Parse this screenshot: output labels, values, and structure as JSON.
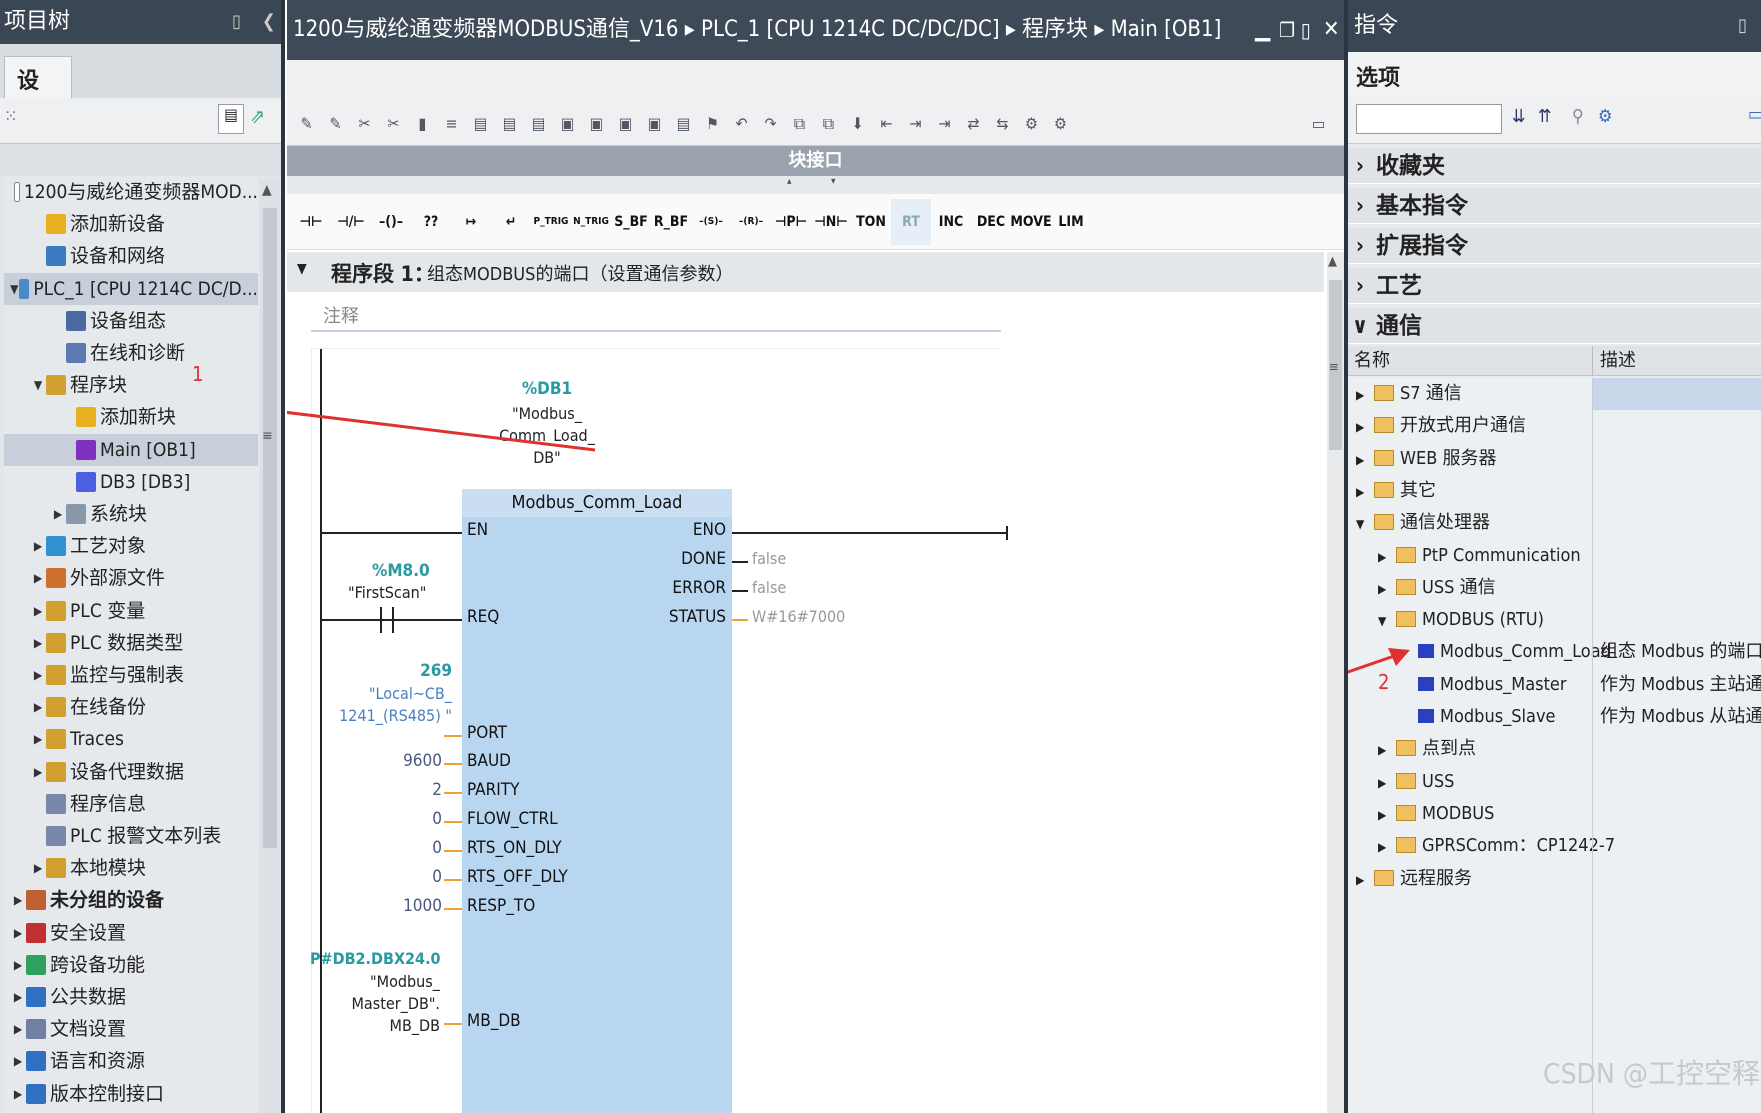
{
  "left_panel": {
    "title": "项目树",
    "tab": "设备",
    "tree": [
      {
        "label": "1200与威纶通变频器MOD...",
        "indent": 0,
        "arrow": "",
        "icon": "#fff",
        "border": "#888"
      },
      {
        "label": "添加新设备",
        "indent": 1,
        "arrow": "",
        "icon": "#e8b020"
      },
      {
        "label": "设备和网络",
        "indent": 1,
        "arrow": "",
        "icon": "#3a7ac0"
      },
      {
        "label": "PLC_1 [CPU 1214C DC/D...",
        "indent": 0,
        "arrow": "▼",
        "icon": "#4a8ac8",
        "hl": true
      },
      {
        "label": "设备组态",
        "indent": 2,
        "arrow": "",
        "icon": "#4a6aa0"
      },
      {
        "label": "在线和诊断",
        "indent": 2,
        "arrow": "",
        "icon": "#5a7ab0"
      },
      {
        "label": "程序块",
        "indent": 1,
        "arrow": "▼",
        "icon": "#d0a030"
      },
      {
        "label": "添加新块",
        "indent": 2.5,
        "arrow": "",
        "icon": "#e8b020"
      },
      {
        "label": "Main [OB1]",
        "indent": 2.5,
        "arrow": "",
        "icon": "#8030c0",
        "hl": true
      },
      {
        "label": "DB3 [DB3]",
        "indent": 2.5,
        "arrow": "",
        "icon": "#4a60e0"
      },
      {
        "label": "系统块",
        "indent": 2,
        "arrow": "▶",
        "icon": "#8899aa"
      },
      {
        "label": "工艺对象",
        "indent": 1,
        "arrow": "▶",
        "icon": "#3090d0"
      },
      {
        "label": "外部源文件",
        "indent": 1,
        "arrow": "▶",
        "icon": "#d07030"
      },
      {
        "label": "PLC 变量",
        "indent": 1,
        "arrow": "▶",
        "icon": "#d0a030"
      },
      {
        "label": "PLC 数据类型",
        "indent": 1,
        "arrow": "▶",
        "icon": "#d0a030"
      },
      {
        "label": "监控与强制表",
        "indent": 1,
        "arrow": "▶",
        "icon": "#d0a030"
      },
      {
        "label": "在线备份",
        "indent": 1,
        "arrow": "▶",
        "icon": "#d0a030"
      },
      {
        "label": "Traces",
        "indent": 1,
        "arrow": "▶",
        "icon": "#d0a030"
      },
      {
        "label": "设备代理数据",
        "indent": 1,
        "arrow": "▶",
        "icon": "#d0a030"
      },
      {
        "label": "程序信息",
        "indent": 1,
        "arrow": "",
        "icon": "#7788aa"
      },
      {
        "label": "PLC 报警文本列表",
        "indent": 1,
        "arrow": "",
        "icon": "#7788aa"
      },
      {
        "label": "本地模块",
        "indent": 1,
        "arrow": "▶",
        "icon": "#d0a030"
      },
      {
        "label": "未分组的设备",
        "indent": 0,
        "arrow": "▶",
        "icon": "#c06030",
        "bold": true
      },
      {
        "label": "安全设置",
        "indent": 0,
        "arrow": "▶",
        "icon": "#c03030"
      },
      {
        "label": "跨设备功能",
        "indent": 0,
        "arrow": "▶",
        "icon": "#30a060"
      },
      {
        "label": "公共数据",
        "indent": 0,
        "arrow": "▶",
        "icon": "#3070c0"
      },
      {
        "label": "文档设置",
        "indent": 0,
        "arrow": "▶",
        "icon": "#7080a0"
      },
      {
        "label": "语言和资源",
        "indent": 0,
        "arrow": "▶",
        "icon": "#3070c0"
      },
      {
        "label": "版本控制接口",
        "indent": 0,
        "arrow": "▶",
        "icon": "#3070c0"
      }
    ],
    "annotation": "1"
  },
  "main": {
    "breadcrumb": "1200与威纶通变频器MODBUS通信_V16 ▸ PLC_1 [CPU 1214C DC/DC/DC] ▸ 程序块 ▸ Main [OB1]",
    "block_interface": "块接口",
    "ladder_buttons": [
      "⊣⊢",
      "⊣/⊢",
      "–()–",
      "??",
      "↦",
      "↵",
      "P_TRIG",
      "N_TRIG",
      "S_BF",
      "R_BF",
      "–(S)–",
      "–(R)–",
      "⊣P⊢",
      "⊣N⊢",
      "TON",
      "RT",
      "INC",
      "DEC",
      "MOVE",
      "LIM"
    ],
    "network_label": "程序段 1：",
    "network_title": "组态MODBUS的端口（设置通信参数）",
    "comment_placeholder": "注释",
    "instance_db_addr": "%DB1",
    "instance_db_name": "\"Modbus_ Comm_Load_ DB\"",
    "block_name": "Modbus_Comm_Load",
    "inputs": [
      {
        "pin": "EN",
        "param": "",
        "value": ""
      },
      {
        "pin": "REQ",
        "param": "",
        "value": ""
      },
      {
        "pin": "PORT",
        "param": "",
        "value": ""
      },
      {
        "pin": "BAUD",
        "param": "",
        "value": "9600"
      },
      {
        "pin": "PARITY",
        "param": "",
        "value": "2"
      },
      {
        "pin": "FLOW_CTRL",
        "param": "",
        "value": "0"
      },
      {
        "pin": "RTS_ON_DLY",
        "param": "",
        "value": "0"
      },
      {
        "pin": "RTS_OFF_DLY",
        "param": "",
        "value": "0"
      },
      {
        "pin": "RESP_TO",
        "param": "",
        "value": "1000"
      },
      {
        "pin": "MB_DB",
        "param": "",
        "value": ""
      }
    ],
    "outputs": [
      {
        "pin": "ENO",
        "value": ""
      },
      {
        "pin": "DONE",
        "value": "false"
      },
      {
        "pin": "ERROR",
        "value": "false"
      },
      {
        "pin": "STATUS",
        "value": "W#16#7000"
      }
    ],
    "req_addr": "%M8.0",
    "req_name": "\"FirstScan\"",
    "port_value": "269",
    "port_name": "\"Local~CB_ 1241_(RS485) \"",
    "mb_db_addr": "P#DB2.DBX24.0",
    "mb_db_name": "\"Modbus_ Master_DB\". MB_DB"
  },
  "right_panel": {
    "title": "指令",
    "options": "选项",
    "categories": [
      {
        "label": "收藏夹",
        "open": false
      },
      {
        "label": "基本指令",
        "open": false
      },
      {
        "label": "扩展指令",
        "open": false
      },
      {
        "label": "工艺",
        "open": false
      },
      {
        "label": "通信",
        "open": true
      }
    ],
    "col_name": "名称",
    "col_desc": "描述",
    "items": [
      {
        "label": "S7 通信",
        "indent": 0,
        "arrow": "▶",
        "type": "folder",
        "desc": "",
        "sel": true
      },
      {
        "label": "开放式用户通信",
        "indent": 0,
        "arrow": "▶",
        "type": "folder",
        "desc": ""
      },
      {
        "label": "WEB 服务器",
        "indent": 0,
        "arrow": "▶",
        "type": "folder",
        "desc": ""
      },
      {
        "label": "其它",
        "indent": 0,
        "arrow": "▶",
        "type": "folder",
        "desc": ""
      },
      {
        "label": "通信处理器",
        "indent": 0,
        "arrow": "▼",
        "type": "folder",
        "desc": ""
      },
      {
        "label": "PtP Communication",
        "indent": 1,
        "arrow": "▶",
        "type": "folder",
        "desc": ""
      },
      {
        "label": "USS 通信",
        "indent": 1,
        "arrow": "▶",
        "type": "folder",
        "desc": ""
      },
      {
        "label": "MODBUS (RTU)",
        "indent": 1,
        "arrow": "▼",
        "type": "folder",
        "desc": ""
      },
      {
        "label": "Modbus_Comm_Load",
        "indent": 2,
        "arrow": "",
        "type": "block",
        "desc": "组态 Modbus 的端口"
      },
      {
        "label": "Modbus_Master",
        "indent": 2,
        "arrow": "",
        "type": "block",
        "desc": "作为 Modbus 主站通信"
      },
      {
        "label": "Modbus_Slave",
        "indent": 2,
        "arrow": "",
        "type": "block",
        "desc": "作为 Modbus 从站通信"
      },
      {
        "label": "点到点",
        "indent": 1,
        "arrow": "▶",
        "type": "folder",
        "desc": ""
      },
      {
        "label": "USS",
        "indent": 1,
        "arrow": "▶",
        "type": "folder",
        "desc": ""
      },
      {
        "label": "MODBUS",
        "indent": 1,
        "arrow": "▶",
        "type": "folder",
        "desc": ""
      },
      {
        "label": "GPRSComm：CP1242-7",
        "indent": 1,
        "arrow": "▶",
        "type": "folder",
        "desc": ""
      },
      {
        "label": "远程服务",
        "indent": 0,
        "arrow": "▶",
        "type": "folder",
        "desc": ""
      }
    ],
    "annotation": "2"
  },
  "watermark": "CSDN @工控空释"
}
